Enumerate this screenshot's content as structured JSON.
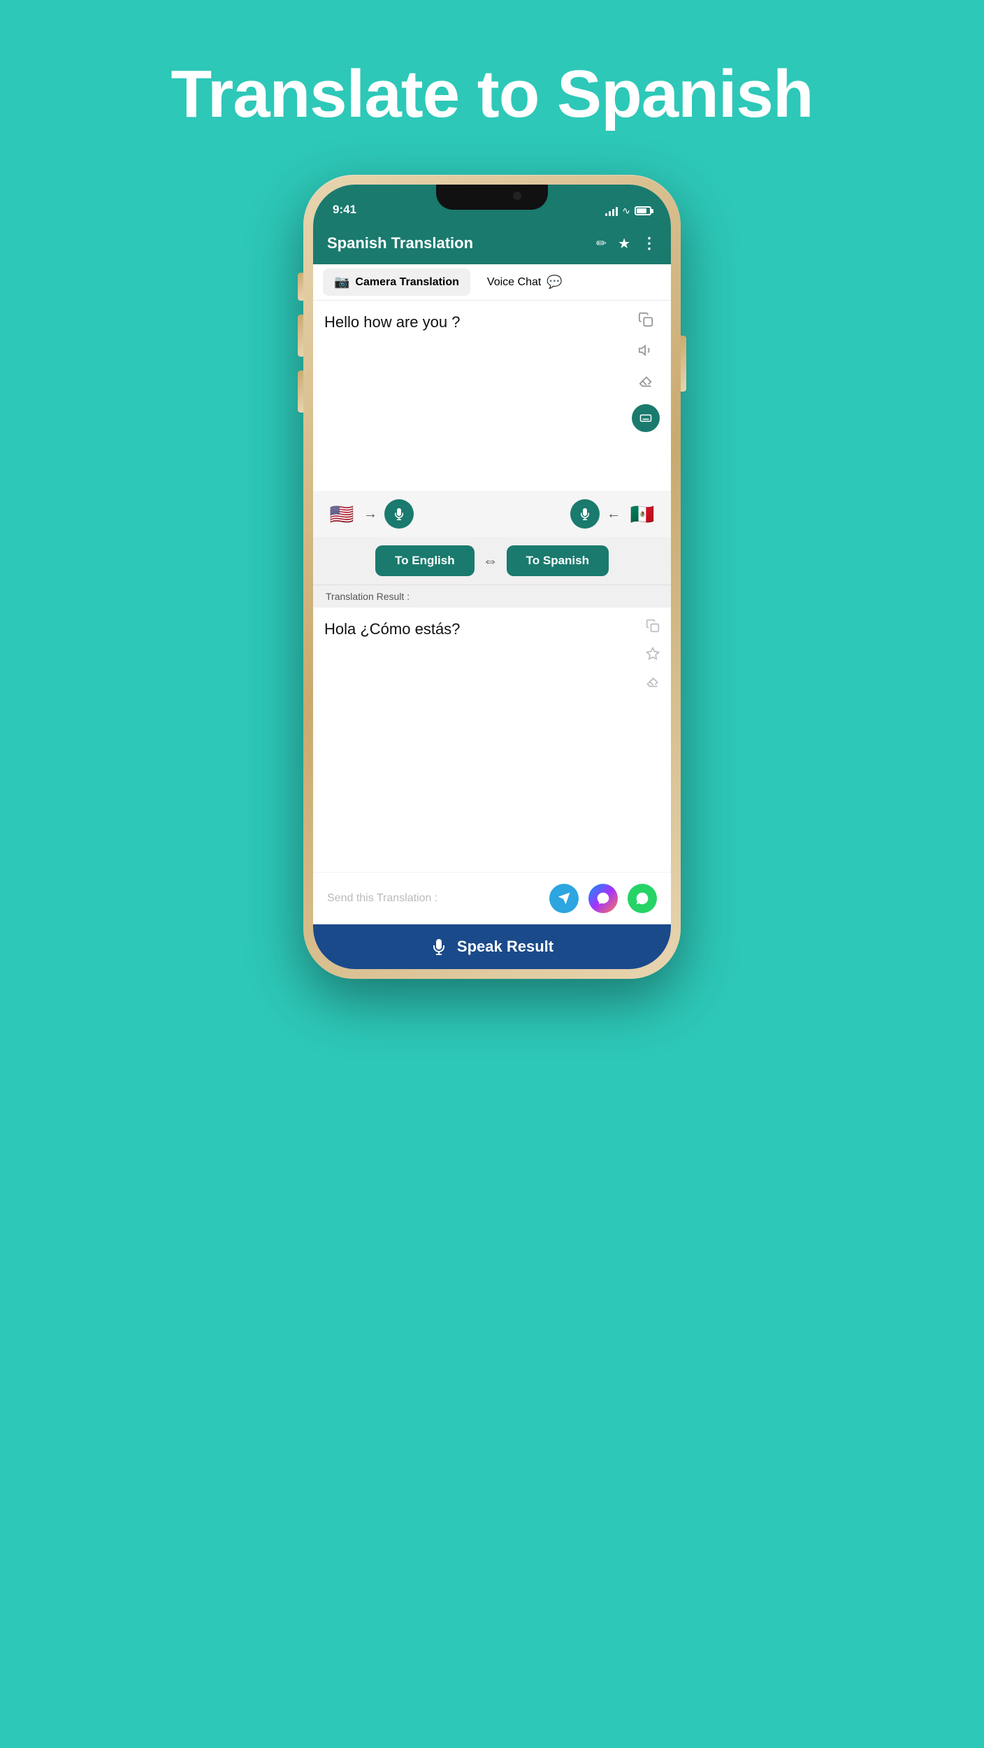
{
  "page": {
    "title": "Translate to Spanish",
    "background_color": "#2dc8b8"
  },
  "status_bar": {
    "time": "9:41",
    "signal": "full",
    "wifi": true,
    "battery": "full"
  },
  "app_header": {
    "title": "Spanish Translation",
    "icons": {
      "edit": "✏",
      "star": "★",
      "more": "⋮"
    }
  },
  "tabs": [
    {
      "label": "Camera Translation",
      "active": true,
      "icon": "📷"
    },
    {
      "label": "Voice Chat",
      "active": false,
      "icon": "💬"
    }
  ],
  "input": {
    "text": "Hello how are you ?",
    "actions": {
      "copy": "⧉",
      "volume": "🔊",
      "erase": "◇",
      "keyboard": "⌨"
    }
  },
  "language_bar": {
    "source_flag": "🇺🇸",
    "target_flag": "🇲🇽",
    "arrow": "→",
    "arrow_back": "←"
  },
  "translate_buttons": {
    "to_english": "To English",
    "to_spanish": "To Spanish",
    "swap": "⇔"
  },
  "result_header": {
    "label": "Translation Result :"
  },
  "result": {
    "text": "Hola ¿Cómo estás?",
    "actions": {
      "copy": "⧉",
      "star_add": "✩+",
      "erase": "◇"
    }
  },
  "share": {
    "label": "Send this Translation :",
    "telegram": "✈",
    "messenger": "m",
    "whatsapp": "W"
  },
  "speak_button": {
    "label": "Speak Result",
    "icon": "🎤"
  }
}
